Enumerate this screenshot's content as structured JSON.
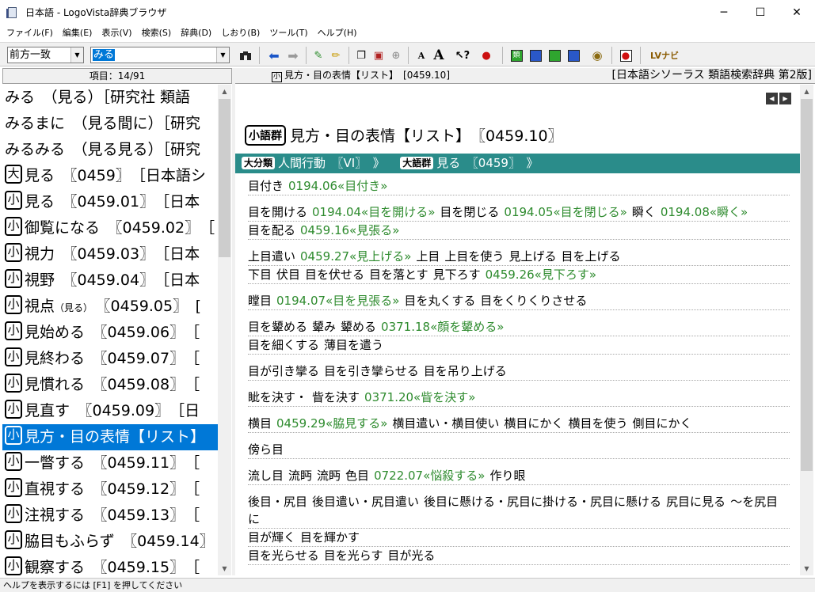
{
  "window": {
    "title": "日本語 - LogoVista辞典ブラウザ",
    "min": "─",
    "max": "☐",
    "close": "✕"
  },
  "menu": [
    "ファイル(F)",
    "編集(E)",
    "表示(V)",
    "検索(S)",
    "辞典(D)",
    "しおり(B)",
    "ツール(T)",
    "ヘルプ(H)"
  ],
  "toolbar": {
    "match_mode": "前方一致",
    "search_value": "みる",
    "lv_label": "LVナビ"
  },
  "left_pane": {
    "header": "項目：14/91",
    "items": [
      {
        "badge": "",
        "text": "みる　（見る）［研究社 類語"
      },
      {
        "badge": "",
        "text": "みるまに　（見る間に）［研究"
      },
      {
        "badge": "",
        "text": "みるみる　（見る見る）［研究"
      },
      {
        "badge": "大",
        "text": "見る　〖0459〗　［日本語シ"
      },
      {
        "badge": "小",
        "text": "見る　〖0459.01〗　［日本"
      },
      {
        "badge": "小",
        "text": "御覧になる　〖0459.02〗　［"
      },
      {
        "badge": "小",
        "text": "視力　〖0459.03〗　［日本"
      },
      {
        "badge": "小",
        "text": "視野　〖0459.04〗　［日本"
      },
      {
        "badge": "小",
        "text": "視点",
        "small": "（見る）",
        "rest": "　〖0459.05〗　["
      },
      {
        "badge": "小",
        "text": "見始める　〖0459.06〗　［"
      },
      {
        "badge": "小",
        "text": "見終わる　〖0459.07〗　［"
      },
      {
        "badge": "小",
        "text": "見慣れる　〖0459.08〗　［"
      },
      {
        "badge": "小",
        "text": "見直す　〖0459.09〗　［日"
      },
      {
        "badge": "小",
        "text": "見方・目の表情【リスト】",
        "selected": true
      },
      {
        "badge": "小",
        "text": "一瞥する　〖0459.11〗　［"
      },
      {
        "badge": "小",
        "text": "直視する　〖0459.12〗　［"
      },
      {
        "badge": "小",
        "text": "注視する　〖0459.13〗　［"
      },
      {
        "badge": "小",
        "text": "脇目もふらず　〖0459.14〗"
      },
      {
        "badge": "小",
        "text": "観察する　〖0459.15〗　［"
      }
    ]
  },
  "right_pane": {
    "header_badge": "小",
    "header_left": "見方・目の表情【リスト】　[0459.10]",
    "header_right": "[日本語シソーラス 類語検索辞典 第2版]",
    "heading_tag": "小語群",
    "heading_title": "見方・目の表情【リスト】　〖0459.10〗",
    "breadcrumb": {
      "tag1": "大分類",
      "text1": "人間行動　〖VI〗　》",
      "tag2": "大語群",
      "text2": "見る　〖0459〗　》"
    },
    "rows": [
      [
        {
          "t": "目付き"
        },
        {
          "t": "0194.06«目付き»",
          "ref": true
        }
      ],
      [
        {
          "t": "目を開ける"
        },
        {
          "t": "0194.04«目を開ける»",
          "ref": true
        },
        {
          "t": "目を閉じる"
        },
        {
          "t": "0194.05«目を閉じる»",
          "ref": true
        },
        {
          "t": "瞬く"
        },
        {
          "t": "0194.08«瞬く»",
          "ref": true
        }
      ],
      [
        {
          "t": "目を配る"
        },
        {
          "t": "0459.16«見張る»",
          "ref": true
        }
      ],
      [
        {
          "t": "上目遣い"
        },
        {
          "t": "0459.27«見上げる»",
          "ref": true
        },
        {
          "t": "上目"
        },
        {
          "t": "上目を使う"
        },
        {
          "t": "見上げる"
        },
        {
          "t": "目を上げる"
        }
      ],
      [
        {
          "t": "下目"
        },
        {
          "t": "伏目"
        },
        {
          "t": "目を伏せる"
        },
        {
          "t": "目を落とす"
        },
        {
          "t": "見下ろす"
        },
        {
          "t": "0459.26«見下ろす»",
          "ref": true
        }
      ],
      [
        {
          "t": "瞠目"
        },
        {
          "t": "0194.07«目を見張る»",
          "ref": true
        },
        {
          "t": "目を丸くする"
        },
        {
          "t": "目をくりくりさせる"
        }
      ],
      [
        {
          "t": "目を顰める"
        },
        {
          "t": "顰み"
        },
        {
          "t": "顰める"
        },
        {
          "t": "0371.18«顔を顰める»",
          "ref": true
        }
      ],
      [
        {
          "t": "目を細くする"
        },
        {
          "t": "薄目を遣う"
        }
      ],
      [
        {
          "t": "目が引き攣る"
        },
        {
          "t": "目を引き攣らせる"
        },
        {
          "t": "目を吊り上げる"
        }
      ],
      [
        {
          "t": "眦を決す・"
        },
        {
          "t": "眥を決す"
        },
        {
          "t": "0371.20«眥を決す»",
          "ref": true
        }
      ],
      [
        {
          "t": "横目"
        },
        {
          "t": "0459.29«脇見する»",
          "ref": true
        },
        {
          "t": "横目遣い・横目使い"
        },
        {
          "t": "横目にかく"
        },
        {
          "t": "横目を使う"
        },
        {
          "t": "側目にかく"
        }
      ],
      [
        {
          "t": "傍ら目"
        }
      ],
      [
        {
          "t": "流し目"
        },
        {
          "t": "流眄"
        },
        {
          "t": "流眄"
        },
        {
          "t": "色目"
        },
        {
          "t": "0722.07«悩殺する»",
          "ref": true
        },
        {
          "t": "作り眼"
        }
      ],
      [
        {
          "t": "後目・尻目"
        },
        {
          "t": "後目遣い・尻目遣い"
        },
        {
          "t": "後目に懸ける・尻目に掛ける・尻目に懸ける"
        },
        {
          "t": "尻目に見る"
        },
        {
          "t": "〜を尻目に"
        }
      ],
      [
        {
          "t": "目が輝く"
        },
        {
          "t": "目を輝かす"
        }
      ],
      [
        {
          "t": "目を光らせる"
        },
        {
          "t": "目を光らす"
        },
        {
          "t": "目が光る"
        }
      ]
    ]
  },
  "statusbar": "ヘルプを表示するには [F1] を押してください"
}
